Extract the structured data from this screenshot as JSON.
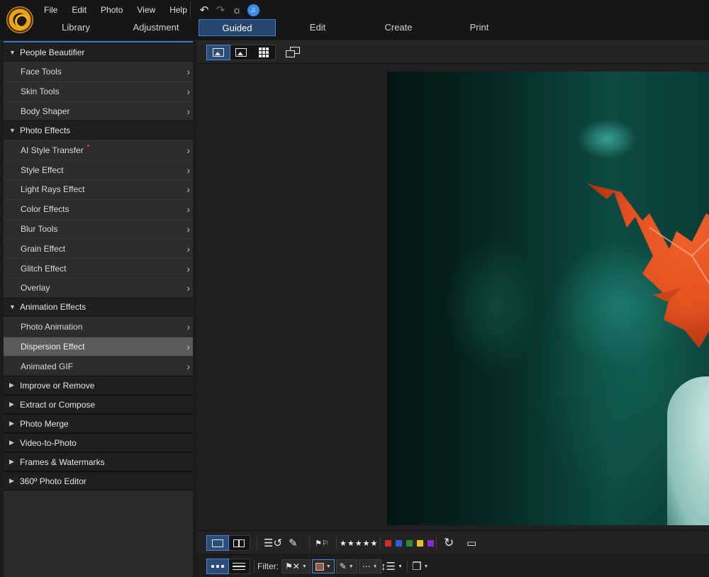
{
  "menu": [
    "File",
    "Edit",
    "Photo",
    "View",
    "Help"
  ],
  "quick_tools": [
    {
      "icon": "undo-icon",
      "glyph": "↶"
    },
    {
      "icon": "redo-icon",
      "glyph": "↷"
    },
    {
      "icon": "settings-icon",
      "glyph": "☼"
    },
    {
      "icon": "notification-bell-icon",
      "glyph": "♫"
    }
  ],
  "modes": [
    {
      "label": "Library",
      "active": false
    },
    {
      "label": "Adjustment",
      "active": false
    },
    {
      "label": "Guided",
      "active": true
    },
    {
      "label": "Edit",
      "active": false
    },
    {
      "label": "Create",
      "active": false
    },
    {
      "label": "Print",
      "active": false
    }
  ],
  "sidebar": {
    "sections": [
      {
        "label": "People Beautifier",
        "expanded": true,
        "items": [
          {
            "label": "Face Tools"
          },
          {
            "label": "Skin Tools"
          },
          {
            "label": "Body Shaper"
          }
        ]
      },
      {
        "label": "Photo Effects",
        "expanded": true,
        "items": [
          {
            "label": "AI Style Transfer",
            "new": true
          },
          {
            "label": "Style Effect"
          },
          {
            "label": "Light Rays Effect"
          },
          {
            "label": "Color Effects"
          },
          {
            "label": "Blur Tools"
          },
          {
            "label": "Grain Effect"
          },
          {
            "label": "Glitch Effect"
          },
          {
            "label": "Overlay"
          }
        ]
      },
      {
        "label": "Animation Effects",
        "expanded": true,
        "items": [
          {
            "label": "Photo Animation"
          },
          {
            "label": "Dispersion Effect",
            "selected": true
          },
          {
            "label": "Animated GIF"
          }
        ]
      },
      {
        "label": "Improve or Remove",
        "expanded": false,
        "items": []
      },
      {
        "label": "Extract or Compose",
        "expanded": false,
        "items": []
      },
      {
        "label": "Photo Merge",
        "expanded": false,
        "items": []
      },
      {
        "label": "Video-to-Photo",
        "expanded": false,
        "items": []
      },
      {
        "label": "Frames & Watermarks",
        "expanded": false,
        "items": []
      },
      {
        "label": "360º Photo Editor",
        "expanded": false,
        "items": []
      }
    ]
  },
  "filmstrip": {
    "rating_stars": "★★★★★",
    "color_labels": [
      "#d42a2a",
      "#2f5fd8",
      "#2f8a2f",
      "#e8c21a",
      "#8a2ad0"
    ]
  },
  "filter": {
    "label": "Filter:"
  }
}
